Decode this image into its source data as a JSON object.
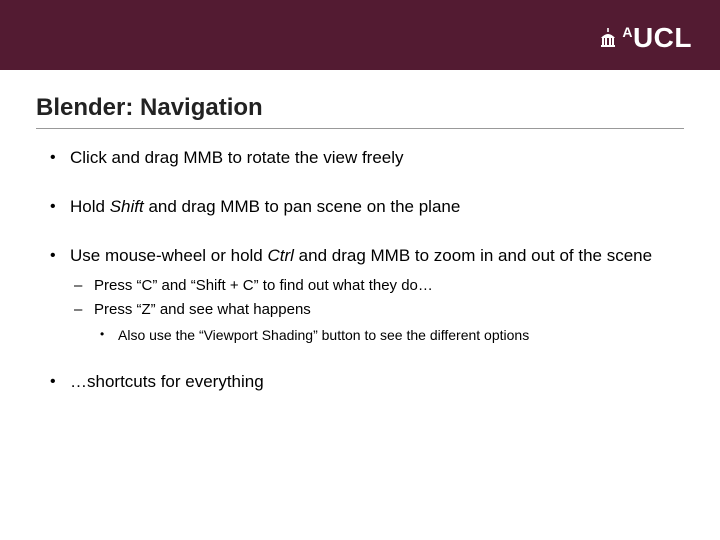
{
  "logo": {
    "sup": "A",
    "main": "UCL"
  },
  "title": "Blender: Navigation",
  "bullets": [
    {
      "pre": "Click and drag MMB to rotate the view freely"
    },
    {
      "pre": "Hold ",
      "ital": "Shift",
      "post": " and drag MMB to pan scene on the plane"
    },
    {
      "pre": "Use mouse-wheel or hold ",
      "ital": "Ctrl",
      "post": " and drag MMB to zoom in and out of the scene",
      "sub": [
        {
          "text": "Press “C” and “Shift + C” to find out what they do…"
        },
        {
          "text": "Press “Z” and see what happens",
          "sub": [
            "Also use the “Viewport Shading” button to see the different options"
          ]
        }
      ]
    },
    {
      "pre": "…shortcuts for everything"
    }
  ]
}
